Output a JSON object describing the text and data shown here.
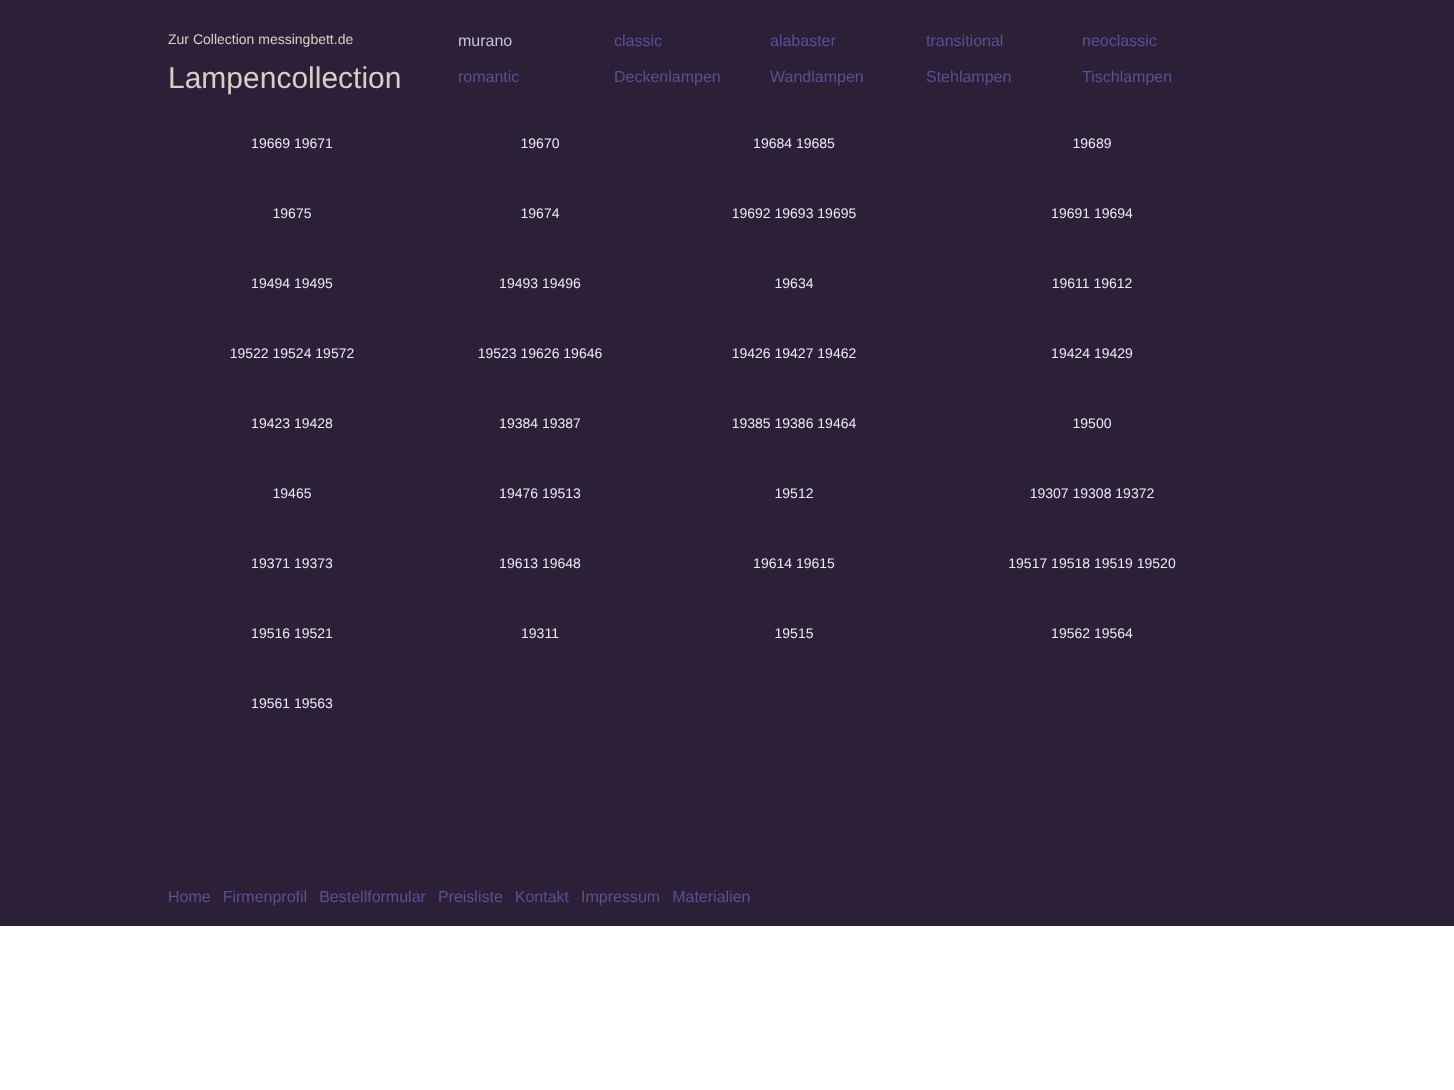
{
  "header": {
    "tagline": "Zur Collection messingbett.de",
    "title": "Lampencollection"
  },
  "nav": [
    {
      "label": "murano",
      "selected": true
    },
    {
      "label": "classic",
      "selected": false
    },
    {
      "label": "alabaster",
      "selected": false
    },
    {
      "label": "transitional",
      "selected": false
    },
    {
      "label": "neoclassic",
      "selected": false
    },
    {
      "label": "romantic",
      "selected": false
    },
    {
      "label": "Deckenlampen",
      "selected": false
    },
    {
      "label": "Wandlampen",
      "selected": false
    },
    {
      "label": "Stehlampen",
      "selected": false
    },
    {
      "label": "Tischlampen",
      "selected": false
    }
  ],
  "grid": [
    [
      "19669 19671",
      "19670",
      "19684 19685",
      "19689"
    ],
    [
      "19675",
      "19674",
      "19692 19693 19695",
      "19691 19694"
    ],
    [
      "19494 19495",
      "19493 19496",
      "19634",
      "19611 19612"
    ],
    [
      "19522 19524 19572",
      "19523 19626 19646",
      "19426 19427 19462",
      "19424 19429"
    ],
    [
      "19423 19428",
      "19384 19387",
      "19385 19386 19464",
      "19500"
    ],
    [
      "19465",
      "19476 19513",
      "19512",
      "19307 19308 19372"
    ],
    [
      "19371 19373",
      "19613 19648",
      "19614 19615",
      "19517 19518 19519 19520"
    ],
    [
      "19516 19521",
      "19311",
      "19515",
      "19562 19564"
    ],
    [
      "19561 19563"
    ]
  ],
  "footer": [
    "Home",
    "Firmenprofil",
    "Bestellformular",
    "Preisliste",
    "Kontakt",
    "Impressum",
    "Materialien"
  ]
}
